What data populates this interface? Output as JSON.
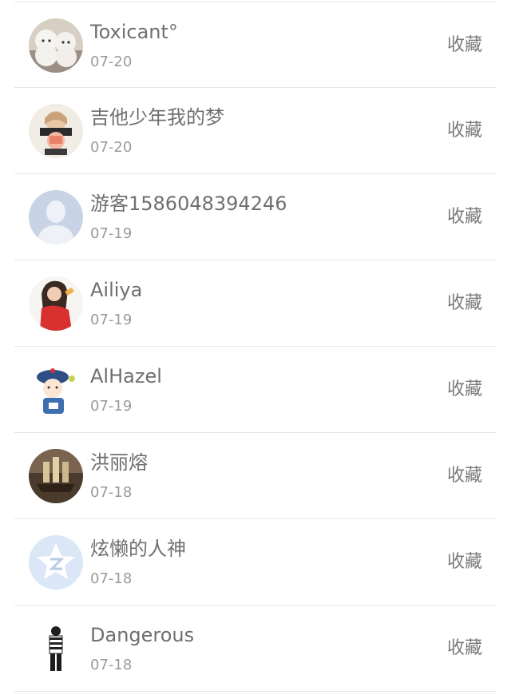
{
  "comments": [
    {
      "name": "Toxicant°",
      "date": "07-20",
      "action": "收藏",
      "avatar": "two-white-dogs-avatar"
    },
    {
      "name": "吉他少年我的梦",
      "date": "07-20",
      "action": "收藏",
      "avatar": "cartoon-girl-avatar"
    },
    {
      "name": "游客1586048394246",
      "date": "07-19",
      "action": "收藏",
      "avatar": "default-guest-avatar"
    },
    {
      "name": "Ailiya",
      "date": "07-19",
      "action": "收藏",
      "avatar": "girl-red-sweater-avatar"
    },
    {
      "name": "AlHazel",
      "date": "07-19",
      "action": "收藏",
      "avatar": "qing-cartoon-avatar"
    },
    {
      "name": "洪丽熔",
      "date": "07-18",
      "action": "收藏",
      "avatar": "sailing-ship-avatar"
    },
    {
      "name": "炫懒的人神",
      "date": "07-18",
      "action": "收藏",
      "avatar": "qzone-star-avatar"
    },
    {
      "name": "Dangerous",
      "date": "07-18",
      "action": "收藏",
      "avatar": "striped-figure-avatar"
    }
  ]
}
